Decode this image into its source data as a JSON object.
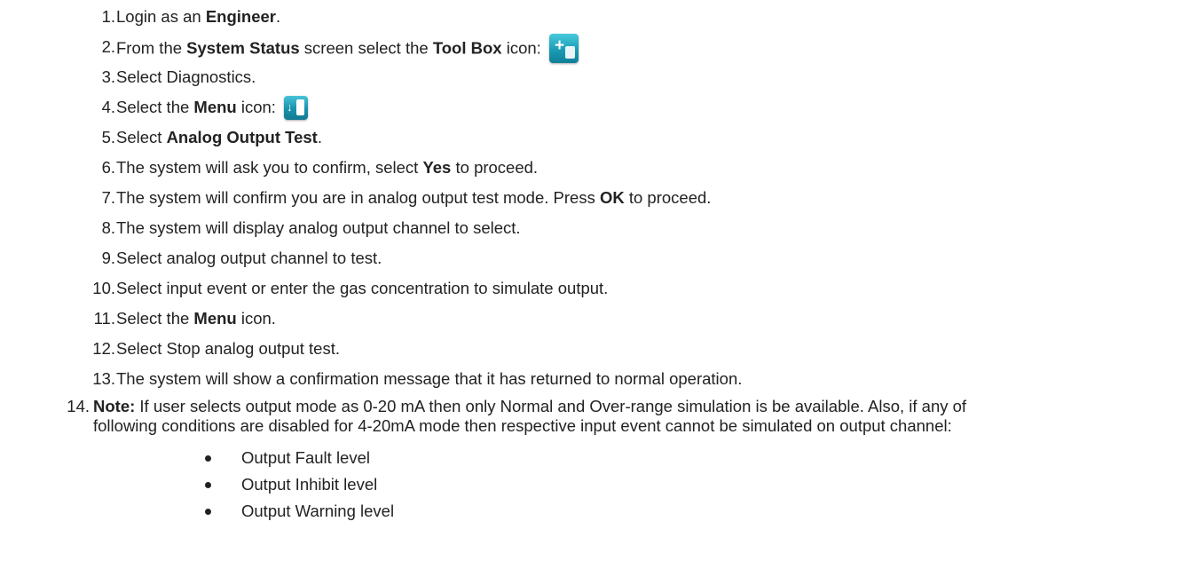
{
  "steps": [
    {
      "num": "1.",
      "parts": [
        {
          "t": "Login as an "
        },
        {
          "b": "Engineer"
        },
        {
          "t": "."
        }
      ]
    },
    {
      "num": "2.",
      "parts": [
        {
          "t": "From the "
        },
        {
          "b": "System Status"
        },
        {
          "t": " screen select the "
        },
        {
          "b": "Tool Box"
        },
        {
          "t": " icon: "
        }
      ],
      "icon": "toolbox-icon"
    },
    {
      "num": "3.",
      "parts": [
        {
          "t": "Select Diagnostics."
        }
      ]
    },
    {
      "num": "4.",
      "parts": [
        {
          "t": "Select the "
        },
        {
          "b": "Menu"
        },
        {
          "t": " icon: "
        }
      ],
      "icon": "menu-icon"
    },
    {
      "num": "5.",
      "parts": [
        {
          "t": "Select "
        },
        {
          "b": "Analog Output Test"
        },
        {
          "t": "."
        }
      ]
    },
    {
      "num": "6.",
      "parts": [
        {
          "t": "The system will ask you to confirm, select "
        },
        {
          "b": "Yes"
        },
        {
          "t": " to proceed."
        }
      ]
    },
    {
      "num": "7.",
      "parts": [
        {
          "t": "The system will confirm you are in analog output test mode. Press "
        },
        {
          "b": "OK"
        },
        {
          "t": " to proceed."
        }
      ]
    },
    {
      "num": "8.",
      "parts": [
        {
          "t": "The system will display analog output channel to select."
        }
      ]
    },
    {
      "num": "9.",
      "parts": [
        {
          "t": "Select analog output channel to test."
        }
      ]
    },
    {
      "num": "10.",
      "parts": [
        {
          "t": "Select input event or enter the gas concentration to simulate output."
        }
      ]
    },
    {
      "num": "11.",
      "parts": [
        {
          "t": "Select the "
        },
        {
          "b": "Menu"
        },
        {
          "t": " icon."
        }
      ]
    },
    {
      "num": "12.",
      "parts": [
        {
          "t": "Select Stop analog output test."
        }
      ]
    },
    {
      "num": "13.",
      "parts": [
        {
          "t": "The system will show a confirmation message that it has returned to normal operation."
        }
      ]
    }
  ],
  "note": {
    "num": "14.",
    "label": "Note:",
    "line1": " If user selects output mode as 0-20 mA then only Normal and Over-range simulation is be available. Also, if any of",
    "line2": "following conditions are disabled for 4-20mA mode then respective input event cannot be simulated on output channel:"
  },
  "bullets": [
    "Output Fault level",
    "Output Inhibit level",
    "Output Warning level"
  ],
  "icons": {
    "toolbox": "toolbox-icon",
    "menu": "menu-icon",
    "accent": "#1a9cb6"
  }
}
